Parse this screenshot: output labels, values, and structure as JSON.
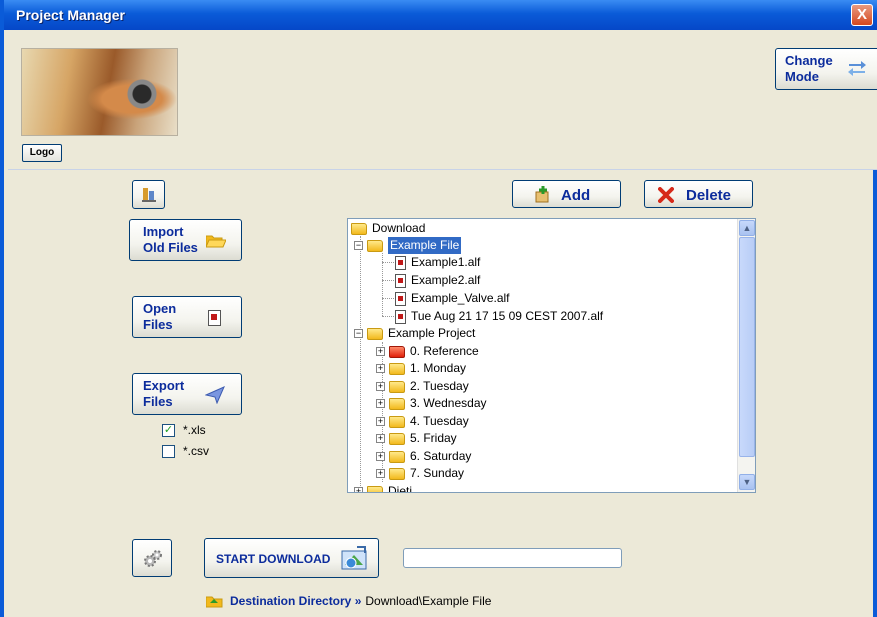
{
  "window": {
    "title": "Project Manager",
    "close_label": "X"
  },
  "header": {
    "logo_button": "Logo",
    "change_mode": [
      "Change",
      "Mode"
    ]
  },
  "toolbar": {
    "add": "Add",
    "delete": "Delete"
  },
  "actions": {
    "import": [
      "Import",
      "Old Files"
    ],
    "open": [
      "Open",
      "Files"
    ],
    "export": [
      "Export",
      "Files"
    ]
  },
  "export_formats": [
    {
      "label": "*.xls",
      "checked": true
    },
    {
      "label": "*.csv",
      "checked": false
    }
  ],
  "tree": {
    "root": "Download",
    "example_file": "Example File",
    "files": [
      "Example1.alf",
      "Example2.alf",
      "Example_Valve.alf",
      "Tue Aug 21 17 15 09 CEST 2007.alf"
    ],
    "example_project": "Example Project",
    "project_items": [
      "0. Reference",
      "1. Monday",
      "2. Tuesday",
      "3. Wednesday",
      "4. Tuesday",
      "5. Friday",
      "6. Saturday",
      "7. Sunday"
    ],
    "cut_item": "Dieti"
  },
  "download": {
    "start_label": "START DOWNLOAD",
    "progress": 0
  },
  "destination": {
    "label": "Destination Directory »",
    "path": "Download\\Example File"
  },
  "colors": {
    "titlebar": "#0a5bd8",
    "button_text": "#0c2c9c",
    "selection": "#316ac5",
    "window_bg": "#ece9d8"
  }
}
